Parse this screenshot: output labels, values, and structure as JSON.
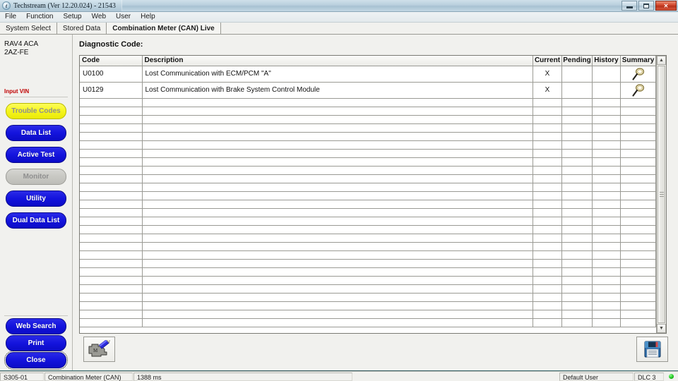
{
  "window": {
    "title": "Techstream (Ver 12.20.024) - 21543",
    "app_icon": "techstream-icon",
    "minimize_label": "",
    "maximize_label": "",
    "close_label": "✕"
  },
  "menu": {
    "items": [
      {
        "label": "File"
      },
      {
        "label": "Function"
      },
      {
        "label": "Setup"
      },
      {
        "label": "Web"
      },
      {
        "label": "User"
      },
      {
        "label": "Help"
      }
    ]
  },
  "tabs": [
    {
      "label": "System Select",
      "active": false
    },
    {
      "label": "Stored Data",
      "active": false
    },
    {
      "label": "Combination Meter (CAN) Live",
      "active": true
    }
  ],
  "sidebar": {
    "vehicle_model": "RAV4 ACA",
    "vehicle_engine": "2AZ-FE",
    "vin_link": "Input VIN",
    "buttons": [
      {
        "label": "Trouble Codes",
        "state": "current"
      },
      {
        "label": "Data List",
        "state": "normal"
      },
      {
        "label": "Active Test",
        "state": "normal"
      },
      {
        "label": "Monitor",
        "state": "disabled"
      },
      {
        "label": "Utility",
        "state": "normal"
      },
      {
        "label": "Dual Data List",
        "state": "normal"
      }
    ],
    "bottom_buttons": [
      {
        "label": "Web Search",
        "state": "normal"
      },
      {
        "label": "Print",
        "state": "normal"
      },
      {
        "label": "Close",
        "state": "focused"
      }
    ]
  },
  "main": {
    "section_title": "Diagnostic Code:",
    "columns": [
      {
        "key": "code",
        "label": "Code"
      },
      {
        "key": "description",
        "label": "Description"
      },
      {
        "key": "current",
        "label": "Current"
      },
      {
        "key": "pending",
        "label": "Pending"
      },
      {
        "key": "history",
        "label": "History"
      },
      {
        "key": "summary",
        "label": "Summary"
      }
    ],
    "rows": [
      {
        "code": "U0100",
        "description": "Lost Communication with ECM/PCM \"A\"",
        "current": "X",
        "pending": "",
        "history": "",
        "summary_icon": "magnifier-icon"
      },
      {
        "code": "U0129",
        "description": "Lost Communication with Brake System Control Module",
        "current": "X",
        "pending": "",
        "history": "",
        "summary_icon": "magnifier-icon"
      }
    ],
    "empty_row_count": 27,
    "scrollbar": {
      "up_arrow": "▲",
      "down_arrow": "▼"
    },
    "toolbar": {
      "engine_button_icon": "engine-edit-icon",
      "save_button_icon": "floppy-save-icon"
    }
  },
  "statusbar": {
    "system_id": "S305-01",
    "system_name": "Combination Meter (CAN)",
    "response_time": "1388 ms",
    "user": "Default User",
    "connector": "DLC 3",
    "connection_indicator": "green-status-dot"
  },
  "colors": {
    "button_blue": "#1414dd",
    "current_yellow": "#f6f621",
    "vin_red": "#c00000",
    "status_green": "#22c422",
    "close_red": "#d2472c"
  }
}
